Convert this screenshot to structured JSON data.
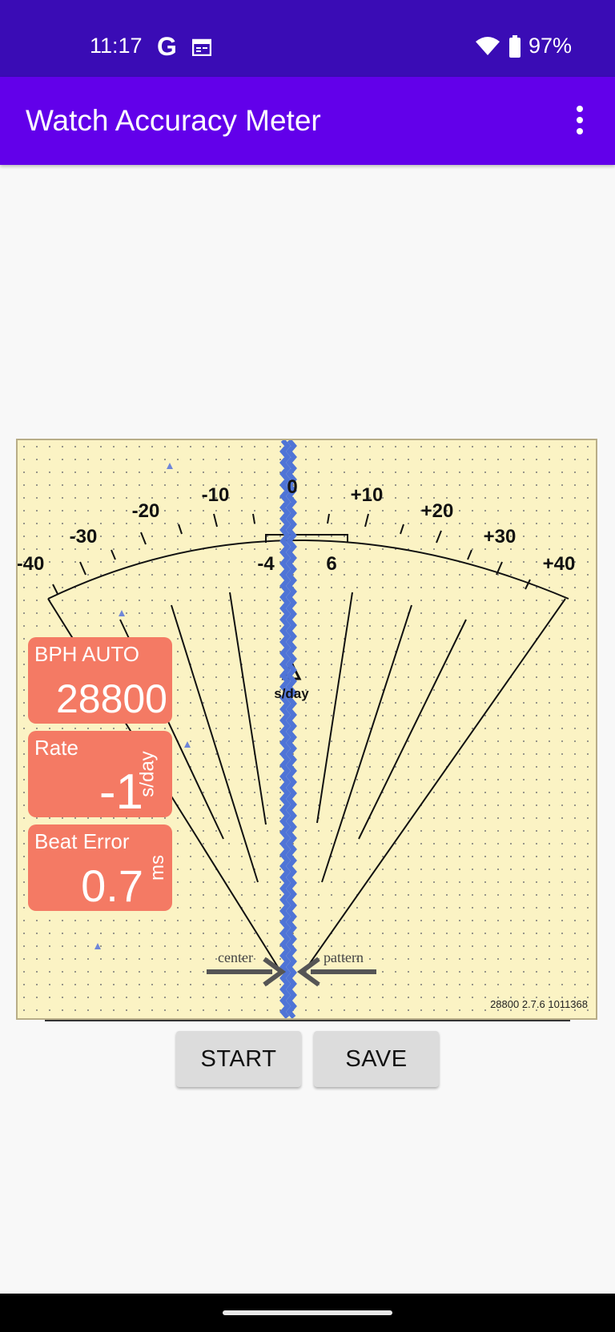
{
  "status_bar": {
    "time": "11:17",
    "g_label": "G",
    "battery": "97%",
    "icons": [
      "google-icon",
      "calendar-icon",
      "wifi-icon",
      "battery-icon"
    ]
  },
  "app_bar": {
    "title": "Watch Accuracy Meter",
    "menu_icon": "overflow-menu-icon"
  },
  "meter": {
    "scale_labels": [
      "-40",
      "-30",
      "-20",
      "-10",
      "0",
      "+10",
      "+20",
      "+30",
      "+40"
    ],
    "bracket_left": "-4",
    "bracket_right": "6",
    "unit": "s/day",
    "center_label": "center",
    "pattern_label": "pattern",
    "version": "28800 2.7.6 1011368",
    "colors": {
      "background": "#fbf3c4",
      "trace": "#4f74d6",
      "card": "#f47a64"
    }
  },
  "cards": {
    "bph": {
      "label": "BPH AUTO",
      "value": "28800"
    },
    "rate": {
      "label": "Rate",
      "value": "-1",
      "unit": "s/day"
    },
    "beat_error": {
      "label": "Beat Error",
      "value": "0.7",
      "unit": "ms"
    }
  },
  "buttons": {
    "start": "START",
    "save": "SAVE"
  }
}
